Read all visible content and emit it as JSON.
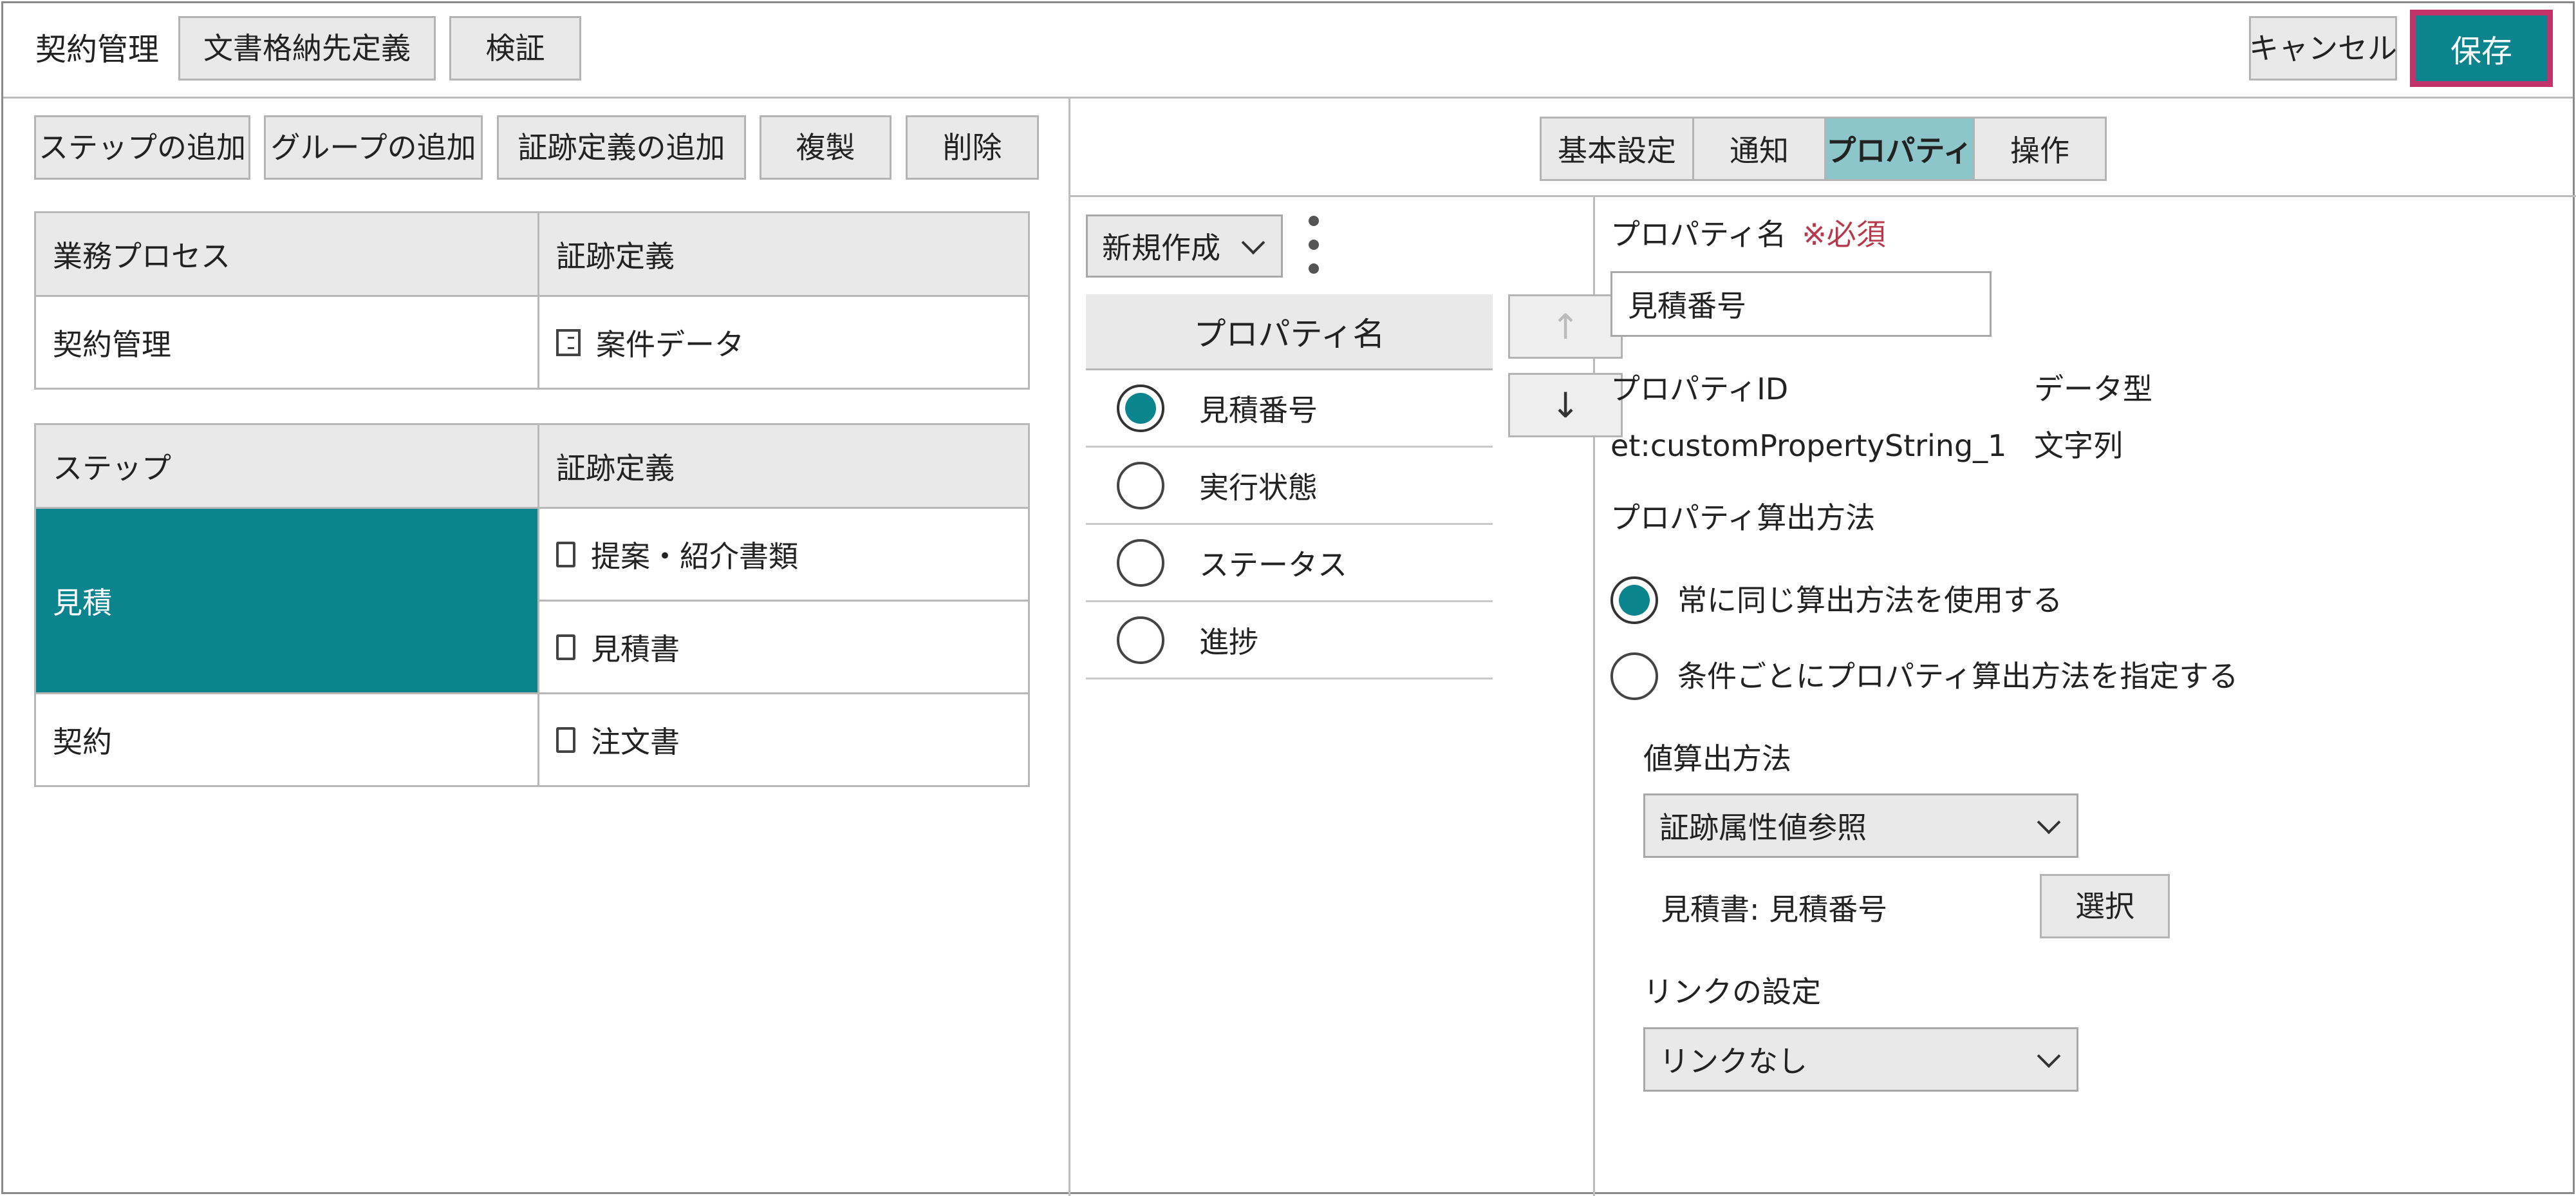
{
  "header": {
    "app_title": "契約管理",
    "storage_def_label": "文書格納先定義",
    "verify_label": "検証",
    "cancel_label": "キャンセル",
    "save_label": "保存"
  },
  "left_toolbar": {
    "add_step": "ステップの追加",
    "add_group": "グループの追加",
    "add_evidence": "証跡定義の追加",
    "duplicate": "複製",
    "delete": "削除"
  },
  "process_table": {
    "headers": [
      "業務プロセス",
      "証跡定義"
    ],
    "row": {
      "process": "契約管理",
      "evidence": "案件データ"
    }
  },
  "step_table": {
    "headers": [
      "ステップ",
      "証跡定義"
    ],
    "rows": [
      {
        "step": "見積",
        "evidence": [
          "提案・紹介書類",
          "見積書"
        ]
      },
      {
        "step": "契約",
        "evidence": [
          "注文書"
        ]
      }
    ]
  },
  "tabs": [
    "基本設定",
    "通知",
    "プロパティ",
    "操作"
  ],
  "active_tab": "プロパティ",
  "property_list": {
    "new_label": "新規作成",
    "header": "プロパティ名",
    "items": [
      "見積番号",
      "実行状態",
      "ステータス",
      "進捗"
    ],
    "selected": "見積番号"
  },
  "detail": {
    "name_label": "プロパティ名",
    "required_label": "※必須",
    "name_value": "見積番号",
    "id_label": "プロパティID",
    "type_label": "データ型",
    "id_value": "et:customPropertyString_1",
    "type_value": "文字列",
    "calc_method_label": "プロパティ算出方法",
    "option_same": "常に同じ算出方法を使用する",
    "option_cond": "条件ごとにプロパティ算出方法を指定する",
    "value_method_label": "値算出方法",
    "value_method_selected": "証跡属性値参照",
    "reference_value": "見積書: 見積番号",
    "select_button": "選択",
    "link_label": "リンクの設定",
    "link_selected": "リンクなし"
  },
  "colors": {
    "accent": "#0b848d",
    "save_border": "#c2336a",
    "active_tab": "#8dc6ca",
    "required": "#b63a4b"
  }
}
